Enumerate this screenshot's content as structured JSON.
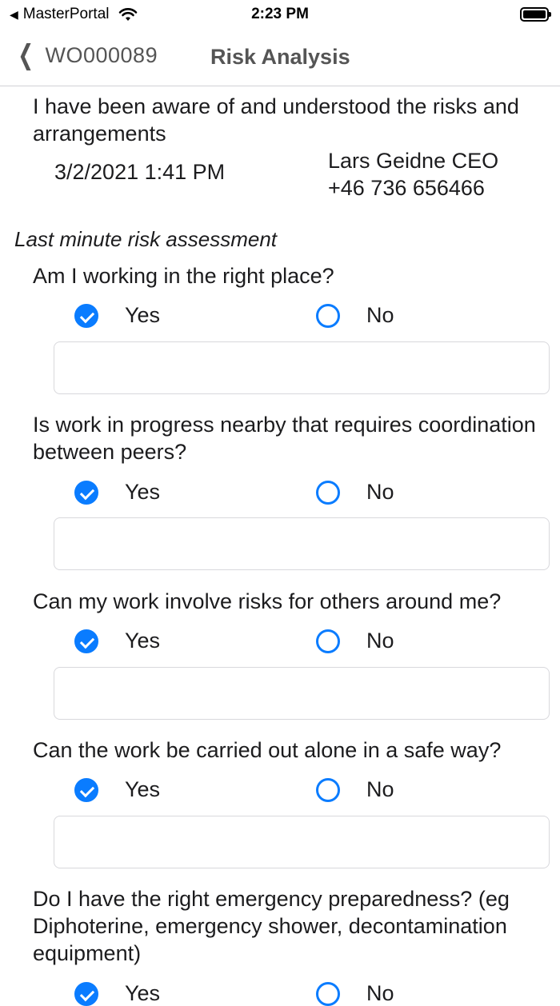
{
  "status_bar": {
    "carrier": "MasterPortal",
    "time": "2:23 PM"
  },
  "nav": {
    "back_label": "WO000089",
    "title": "Risk Analysis"
  },
  "acknowledgement": {
    "text": "I have been aware of and understood the risks and arrangements",
    "date": "3/2/2021 1:41 PM",
    "signer_name": "Lars Geidne CEO",
    "signer_phone": "+46 736 656466"
  },
  "section_title": "Last minute risk assessment",
  "yes_label": "Yes",
  "no_label": "No",
  "questions": [
    {
      "text": "Am I working in the right place?",
      "answer": "Yes",
      "comment": ""
    },
    {
      "text": "Is work in progress nearby that requires coordination between peers?",
      "answer": "Yes",
      "comment": ""
    },
    {
      "text": "Can my work involve risks for others around me?",
      "answer": "Yes",
      "comment": ""
    },
    {
      "text": "Can the work be carried out alone in a safe way?",
      "answer": "Yes",
      "comment": ""
    },
    {
      "text": "Do I have the right emergency preparedness? (eg Diphoterine, emergency shower, decontamination equipment)",
      "answer": "Yes",
      "comment": ""
    }
  ],
  "colors": {
    "accent": "#0a7cff",
    "nav_text": "#555555"
  },
  "icons": {
    "back": "chevron-left-icon",
    "checked": "radio-checked-icon",
    "unchecked": "radio-unchecked-icon"
  }
}
